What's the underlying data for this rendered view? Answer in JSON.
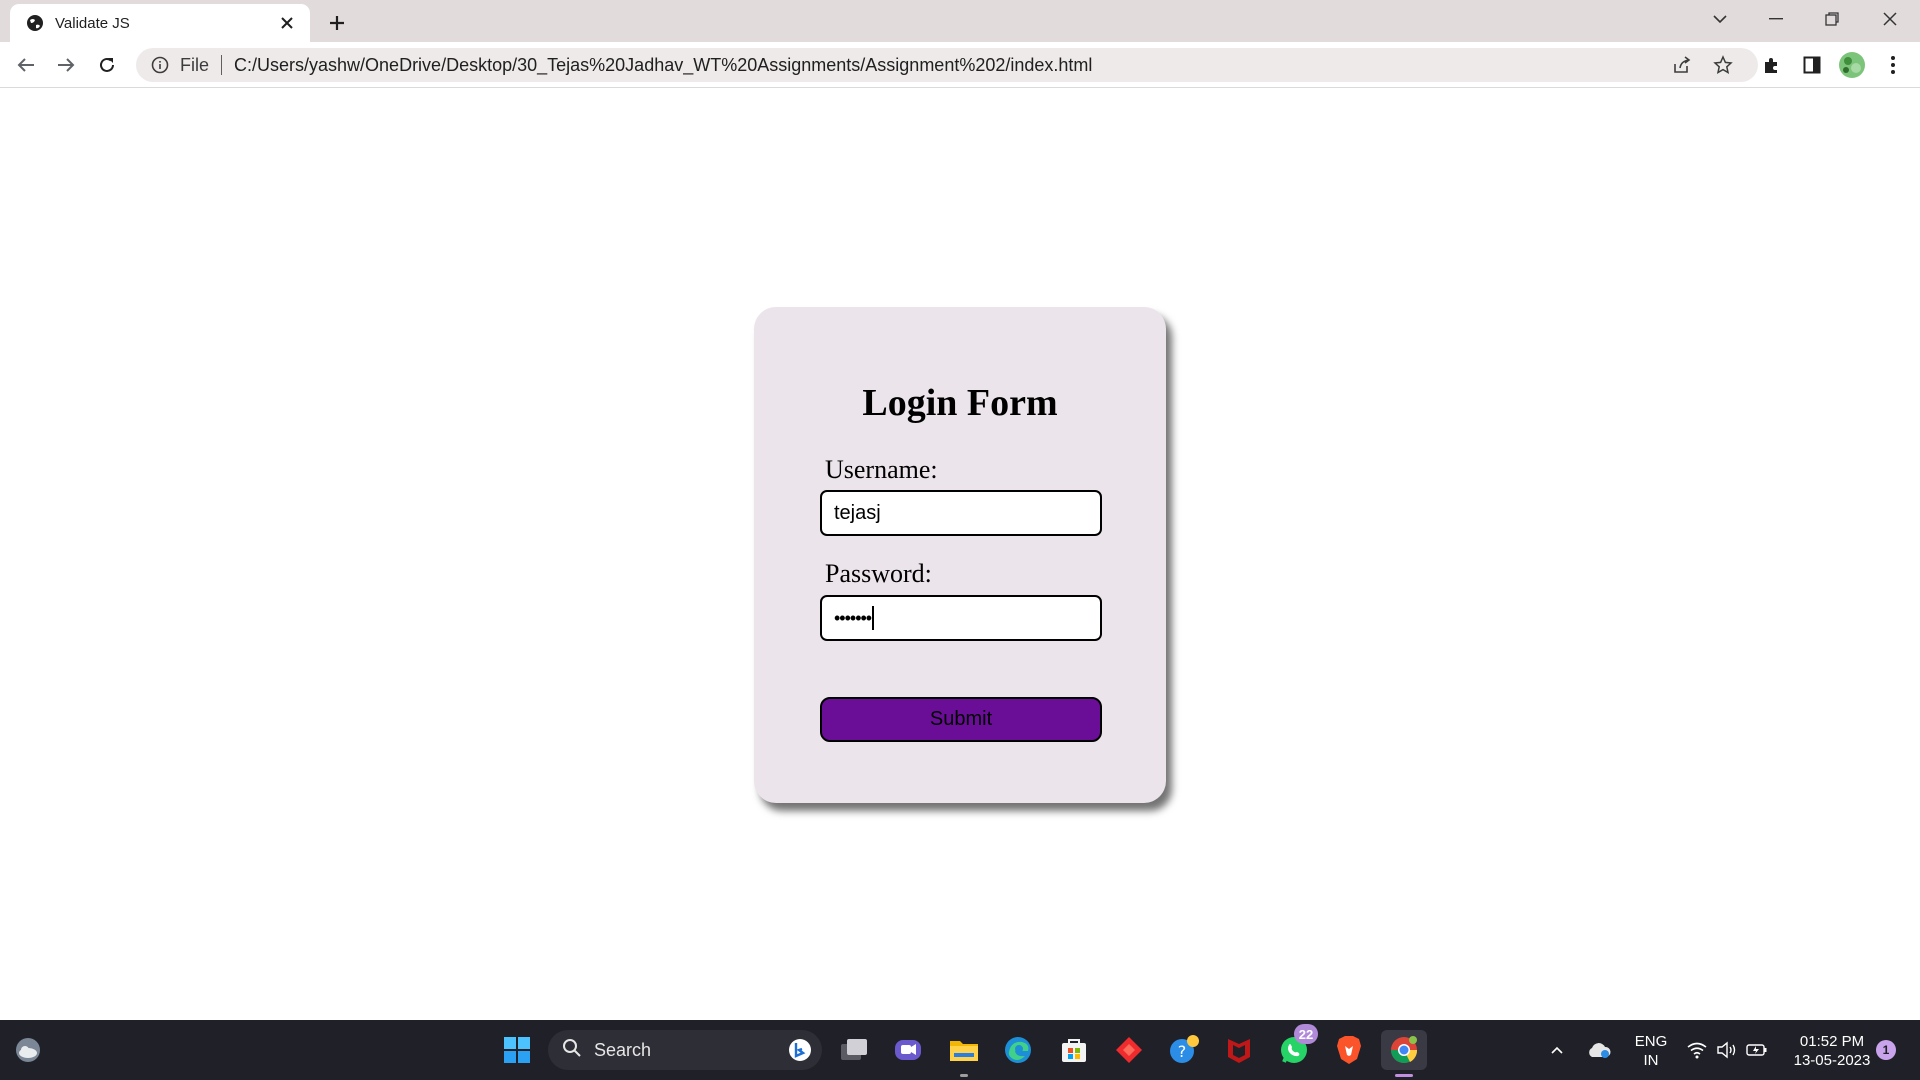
{
  "browser": {
    "tab_title": "Validate JS",
    "new_tab_label": "+",
    "scheme_label": "File",
    "url": "C:/Users/yashw/OneDrive/Desktop/30_Tejas%20Jadhav_WT%20Assignments/Assignment%202/index.html"
  },
  "form": {
    "title": "Login Form",
    "username_label": "Username:",
    "username_value": "tejasj",
    "password_label": "Password:",
    "password_value": "•••••••",
    "submit_label": "Submit",
    "button_color": "#6b0e97",
    "card_color": "#ebe4ea"
  },
  "taskbar": {
    "search_label": "Search",
    "whatsapp_badge": "22",
    "language_line1": "ENG",
    "language_line2": "IN",
    "time": "01:52 PM",
    "date": "13-05-2023",
    "notification_count": "1"
  }
}
